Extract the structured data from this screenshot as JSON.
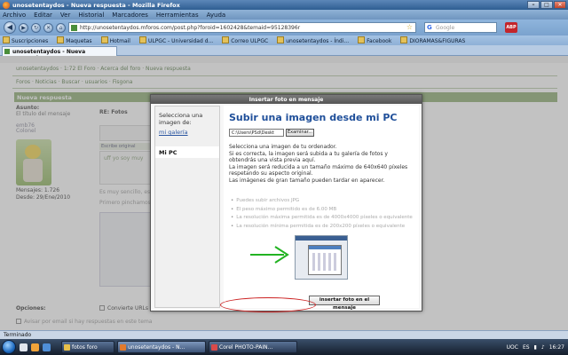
{
  "window": {
    "title": "unosetentaydos - Nueva respuesta - Mozilla Firefox"
  },
  "menu": [
    "Archivo",
    "Editar",
    "Ver",
    "Historial",
    "Marcadores",
    "Herramientas",
    "Ayuda"
  ],
  "nav": {
    "url": "http://unosetentaydos.mforos.com/post.php?foroid=1602428&temaid=95128396r",
    "search_placeholder": "Google",
    "search_engine_letter": "G",
    "adblock_label": "ABP"
  },
  "bookmarks": [
    "Suscripciones",
    "Maquetas",
    "Hotmail",
    "ULPGC - Universidad d...",
    "Correo ULPGC",
    "unosetentaydos - Índi...",
    "Facebook",
    "DIORAMAS&FIGURAS"
  ],
  "tab": {
    "label": "unosetentaydos - Nueva respuesta"
  },
  "page": {
    "breadcrumb": "unosetentaydos · 1:72 El Foro · Acerca del foro · Nueva respuesta",
    "navlinks": "Foros · Noticias · Buscar · usuarios · Fisgona",
    "section_title": "Nueva respuesta",
    "asunto_label": "Asunto:",
    "asunto_value": "El título del mensaje",
    "user_name": "emb76",
    "user_title": "Colonel",
    "messages": "Mensajes: 1.726",
    "since": "Desde: 29/Ene/2010",
    "reply_to": "RE: Fotos",
    "editor_tab": "Escribe original",
    "editor_text": "uff yo soy muy",
    "body_text1": "Es muy sencillo, es",
    "body_text2": "Primero pinchamos",
    "options_label": "Opciones:",
    "option_convert": "Convierte URLs en enlaces",
    "option_notify": "Avisar por email si hay respuestas en este tema"
  },
  "modal": {
    "title": "Insertar foto en mensaje",
    "close": "×",
    "side_heading": "Selecciona una imagen de:",
    "side_link": "mi galería",
    "side_active": "Mi PC",
    "heading": "Subir una imagen desde mi PC",
    "file_value": "C:\\Users\\PSd\\Deskt",
    "browse_label": "Examinar...",
    "instructions": [
      "Selecciona una imagen de tu ordenador.",
      "Si es correcta, la imagen será subida a tu galería de fotos y obtendrás una vista previa aquí.",
      "La imagen será reducida a un tamaño máximo de 640x640 píxeles respetando su aspecto original.",
      "Las imágenes de gran tamaño pueden tardar en aparecer."
    ],
    "limits": [
      "Puedes subir archivos JPG",
      "El peso máximo permitido es de 6.00 MB",
      "La resolución máxima permitida es de 4000x4000 píxeles o equivalente",
      "La resolución mínima permitida es de 200x200 píxeles o equivalente"
    ],
    "submit_label": "insertar foto en el mensaje",
    "arrow_color": "#22b322",
    "highlight_color": "#cc2222"
  },
  "status": {
    "text": "Terminado"
  },
  "taskbar": {
    "buttons": [
      "fotos foro",
      "unosetentaydos - N...",
      "Corel PHOTO-PAIN..."
    ],
    "tray_lang": "ES",
    "tray_vpn": "UOC",
    "clock": "16:27"
  }
}
